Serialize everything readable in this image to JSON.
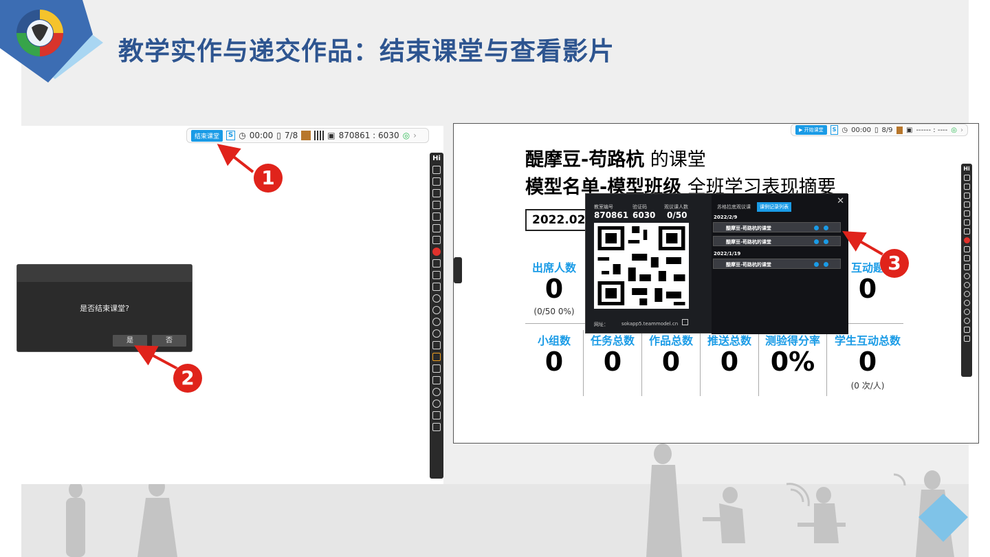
{
  "slide": {
    "title": "教学实作与递交作品：结束课堂与查看影片"
  },
  "left_screenshot": {
    "toolbar": {
      "end_button": "结束课堂",
      "time": "00:00",
      "pages": "7/8",
      "code": "870861 : 6030"
    },
    "dialog": {
      "message": "是否结束课堂?",
      "yes": "是",
      "no": "否"
    },
    "tool_hi": "Hi"
  },
  "right_screenshot": {
    "toolbar": {
      "start_button": "▶ 开始课堂",
      "time": "00:00",
      "pages": "8/9",
      "code": "------ : ----"
    },
    "tool_hi": "Hi",
    "heading1_bold": "醍摩豆-苟路杭",
    "heading1_rest": " 的课堂",
    "heading2_bold": "模型名单-模型班级",
    "heading2_rest": " 全班学习表现摘要",
    "date": "2022.02.0",
    "stats": {
      "attendance_label": "出席人数",
      "attendance_value": "0",
      "attendance_sub": "(0/50 0%)",
      "interaction_label": "互动题",
      "interaction_value": "0",
      "group_label": "小组数",
      "group_value": "0",
      "task_label": "任务总数",
      "task_value": "0",
      "work_label": "作品总数",
      "work_value": "0",
      "push_label": "推送总数",
      "push_value": "0",
      "quiz_label": "测验得分率",
      "quiz_value": "0%",
      "student_label": "学生互动总数",
      "student_value": "0",
      "student_sub": "(0 次/人)"
    },
    "popup": {
      "classroom_no_label": "教室编号",
      "classroom_no": "870861",
      "verify_label": "验证码",
      "verify_code": "6030",
      "observers_label": "观议课人数",
      "observers": "0/50",
      "url_label": "网址：",
      "url": "sokapp5.teammodel.cn",
      "tab1": "苏格拉底观议课",
      "tab2": "课例记录列表",
      "date1": "2022/2/9",
      "date2": "2022/1/19",
      "rows": [
        {
          "title": "醍摩豆-苟路杭的课堂"
        },
        {
          "title": "醍摩豆-苟路杭的课堂"
        },
        {
          "title": "醍摩豆-苟路杭的课堂"
        }
      ],
      "close": "✕"
    }
  },
  "badges": [
    "1",
    "2",
    "3"
  ],
  "colors": {
    "title": "#2e5590",
    "accent": "#1a9be6",
    "badge": "#e0231b"
  }
}
